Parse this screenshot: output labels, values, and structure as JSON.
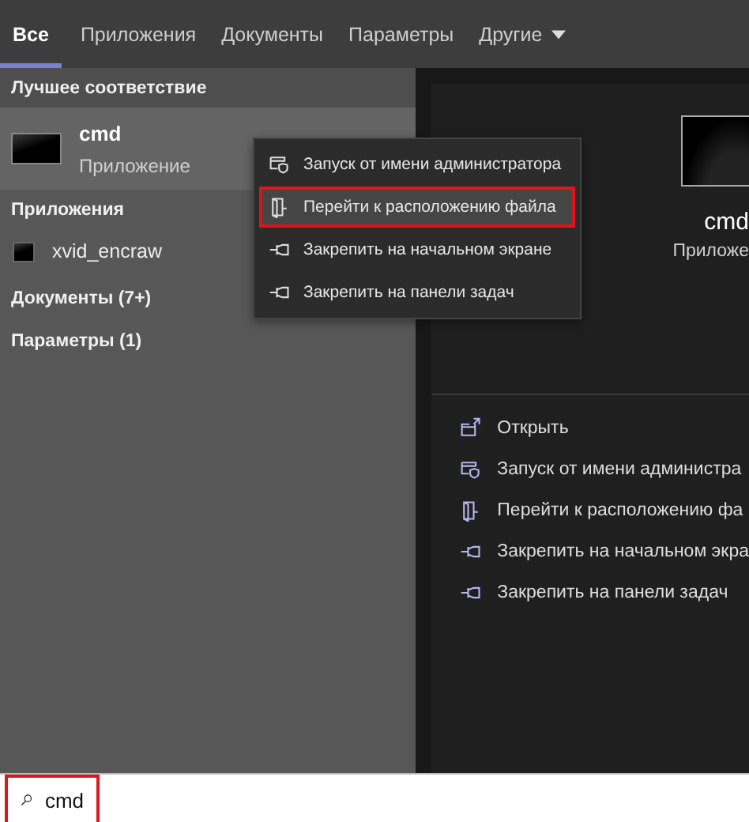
{
  "tabs": [
    {
      "label": "Все",
      "selected": true,
      "dropdown": false
    },
    {
      "label": "Приложения",
      "selected": false,
      "dropdown": false
    },
    {
      "label": "Документы",
      "selected": false,
      "dropdown": false
    },
    {
      "label": "Параметры",
      "selected": false,
      "dropdown": false
    },
    {
      "label": "Другие",
      "selected": false,
      "dropdown": true
    }
  ],
  "best_match": {
    "heading": "Лучшее соответствие",
    "name": "cmd",
    "type": "Приложение",
    "selected": true
  },
  "sections": [
    {
      "heading": "Приложения",
      "items": [
        "xvid_encraw"
      ]
    },
    {
      "heading": "Документы (7+)"
    },
    {
      "heading": "Параметры (1)"
    }
  ],
  "context_menu": [
    {
      "label": "Запуск от имени администратора",
      "kind": "admin",
      "selected": false
    },
    {
      "label": "Перейти к расположению файла",
      "kind": "location",
      "selected": true
    },
    {
      "label": "Закрепить на начальном экране",
      "kind": "pin",
      "selected": false
    },
    {
      "label": "Закрепить на панели задач",
      "kind": "pin",
      "selected": false
    }
  ],
  "preview": {
    "name": "cmd",
    "type": "Приложе"
  },
  "actions": [
    {
      "label": "Открыть",
      "kind": "open"
    },
    {
      "label": "Запуск от имени администра",
      "kind": "admin"
    },
    {
      "label": "Перейти к расположению фа",
      "kind": "location"
    },
    {
      "label": "Закрепить на начальном экра",
      "kind": "pin"
    },
    {
      "label": "Закрепить на панели задач",
      "kind": "pin"
    }
  ],
  "search": {
    "value": "cmd",
    "outlined": true
  }
}
